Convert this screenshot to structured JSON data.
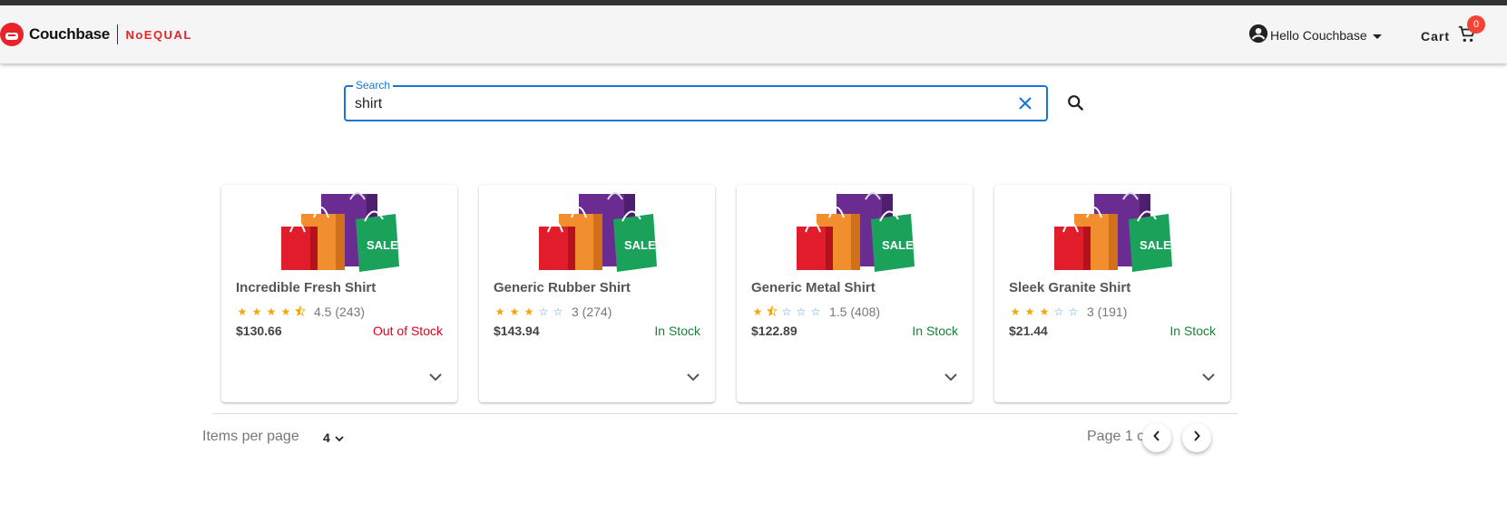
{
  "header": {
    "brand": "Couchbase",
    "sub_brand": "NoEQUAL",
    "user_greeting": "Hello Couchbase",
    "cart_label": "Cart",
    "cart_count": "0"
  },
  "search": {
    "label": "Search",
    "value": "shirt"
  },
  "products": [
    {
      "name": "Incredible Fresh Shirt",
      "rating": 4.5,
      "rating_text": "4.5 (243)",
      "price": "$130.66",
      "stock": "Out of Stock",
      "in_stock": false
    },
    {
      "name": "Generic Rubber Shirt",
      "rating": 3,
      "rating_text": "3 (274)",
      "price": "$143.94",
      "stock": "In Stock",
      "in_stock": true
    },
    {
      "name": "Generic Metal Shirt",
      "rating": 1.5,
      "rating_text": "1.5 (408)",
      "price": "$122.89",
      "stock": "In Stock",
      "in_stock": true
    },
    {
      "name": "Sleek Granite Shirt",
      "rating": 3,
      "rating_text": "3 (191)",
      "price": "$21.44",
      "stock": "In Stock",
      "in_stock": true
    }
  ],
  "pagination": {
    "items_per_page_label": "Items per page",
    "items_per_page": "4",
    "page_info": "Page 1 of 27"
  },
  "colors": {
    "brand_red": "#ea2328",
    "focus_blue": "#1976d2",
    "out_of_stock": "#e3001b",
    "in_stock": "#188038",
    "star": "#f2a600"
  }
}
